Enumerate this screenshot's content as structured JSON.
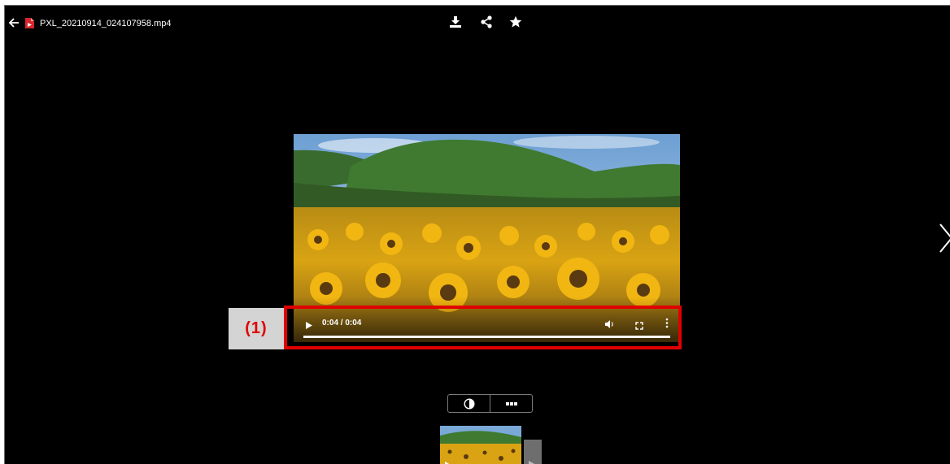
{
  "file": {
    "name": "PXL_20210914_024107958.mp4"
  },
  "toolbar": {
    "back_icon": "arrow-left-icon",
    "file_icon": "video-file-icon",
    "actions": [
      "download-icon",
      "share-icon",
      "star-icon"
    ]
  },
  "player": {
    "time": "0:04 / 0:04",
    "progress": 1.0,
    "controls": [
      "play-icon",
      "volume-icon",
      "fullscreen-icon",
      "more-vert-icon"
    ]
  },
  "annotation": {
    "label": "(1)",
    "color": "#e00000"
  },
  "navigation": {
    "next_icon": "chevron-right-icon"
  },
  "bottom_toolbar": {
    "buttons": [
      "contrast-icon",
      "more-horiz-icon"
    ]
  }
}
